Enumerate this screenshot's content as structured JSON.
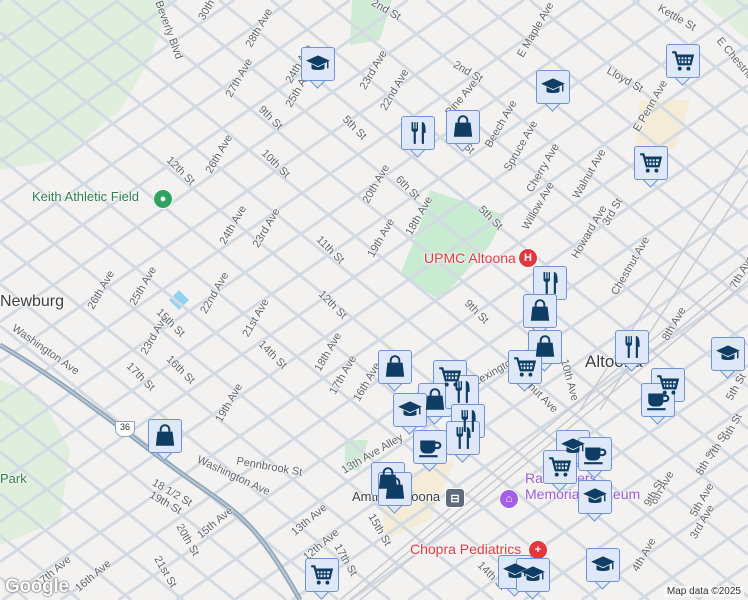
{
  "colors": {
    "marker_fill": "#dfe8f8",
    "marker_border": "#6f93d8",
    "marker_icon": "#0f3d63",
    "hospital": "#e0383e",
    "museum": "#9b59e0",
    "park": "#c8ebd2",
    "highway": "#8fa3b8"
  },
  "places": {
    "keith": "Keith Athletic Field",
    "newburg": "Newburg",
    "upmc": "UPMC Altoona",
    "altoona": "Altoona",
    "amtrak": "Amtrak Altoona",
    "railroad_1": "Railroaders",
    "railroad_2": "Memorial Museum",
    "chopra": "Chopra Pediatrics",
    "park": "Park",
    "route": "36"
  },
  "streets": [
    "2nd St",
    "Kettle St",
    "E Maple Ave",
    "2nd St",
    "Lloyd St",
    "E Penn Ave",
    "E Chestnut Ave",
    "Pine Ave",
    "Beech Ave",
    "Spruce Ave",
    "Cherry Ave",
    "Walnut Ave",
    "3rd St",
    "Willow Ave",
    "Howard Ave",
    "Chestnut Ave",
    "7th Ave",
    "8th Ave",
    "5th St",
    "6th St",
    "5th St",
    "4th St",
    "20th Ave",
    "19th Ave",
    "18th Ave",
    "22nd Ave",
    "23rd Ave",
    "24th Ave",
    "25th Ave",
    "26th Ave",
    "27th Ave",
    "28th Ave",
    "30th",
    "Beverly Blvd",
    "9th St",
    "10th St",
    "12th St",
    "11th St",
    "24th Ave",
    "23rd Ave",
    "22nd Ave",
    "21st Ave",
    "26th Ave",
    "25th Ave",
    "23rd Ave",
    "15th St",
    "16th St",
    "17th St",
    "14th St",
    "12th St",
    "9th St",
    "18th Ave",
    "17th Ave",
    "16th Ave",
    "19th Ave",
    "Lexington Ave",
    "10th Ave",
    "Washington Ave",
    "Washington Ave",
    "Pennbrook St",
    "13th Ave Alley",
    "18 1/2 St",
    "19th St",
    "15th Ave",
    "20th St",
    "13th Ave",
    "12th Ave",
    "17th St",
    "15th St",
    "16th Ave",
    "17th Ave",
    "21st St",
    "14th St",
    "4th Ave",
    "5th Ave",
    "6th Ave",
    "8th St",
    "7th St",
    "6th St",
    "5th St",
    "9th St",
    "3rd Ave",
    "Chestnut Ave"
  ],
  "markers": [
    "graduation-cap",
    "shopping-cart",
    "graduation-cap",
    "fork-knife",
    "shopping-bag",
    "shopping-cart",
    "fork-knife",
    "shopping-bag",
    "shopping-bag",
    "shopping-cart",
    "shopping-bag",
    "shopping-cart",
    "fork-knife",
    "shopping-cart",
    "graduation-cap",
    "coffee-cup",
    "shopping-bag",
    "graduation-cap",
    "fork-knife",
    "fork-knife",
    "fork-knife",
    "coffee-cup",
    "graduation-cap",
    "coffee-cup",
    "shopping-cart",
    "shopping-bag",
    "shopping-bag",
    "graduation-cap",
    "graduation-cap",
    "graduation-cap",
    "graduation-cap",
    "shopping-cart",
    "shopping-bag"
  ],
  "attribution": "Map data ©2025",
  "logo": "Google"
}
